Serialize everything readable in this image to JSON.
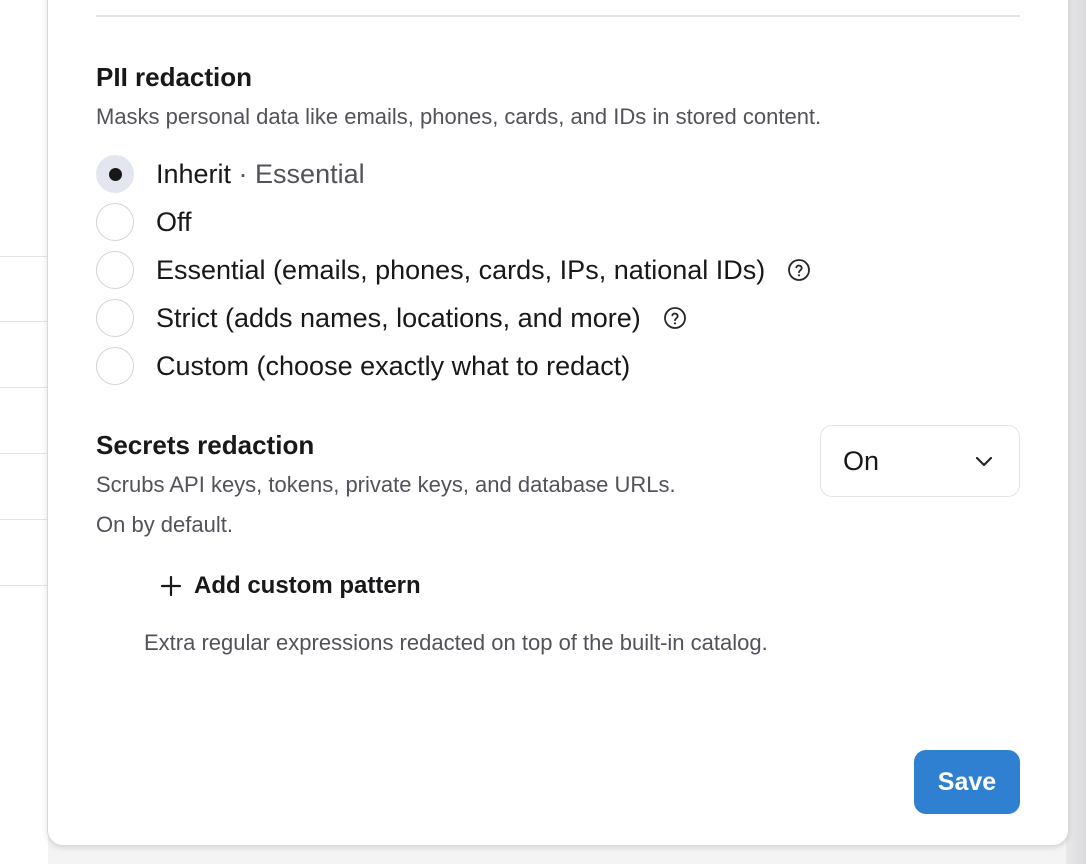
{
  "pii": {
    "title": "PII redaction",
    "description": "Masks personal data like emails, phones, cards, and IDs in stored content.",
    "options": [
      {
        "label": "Inherit",
        "sub": " · Essential",
        "checked": true,
        "help": false
      },
      {
        "label": "Off",
        "sub": "",
        "checked": false,
        "help": false
      },
      {
        "label": "Essential (emails, phones, cards, IPs, national IDs)",
        "sub": "",
        "checked": false,
        "help": true
      },
      {
        "label": "Strict (adds names, locations, and more)",
        "sub": "",
        "checked": false,
        "help": true
      },
      {
        "label": "Custom (choose exactly what to redact)",
        "sub": "",
        "checked": false,
        "help": false
      }
    ]
  },
  "secrets": {
    "title": "Secrets redaction",
    "description": "Scrubs API keys, tokens, private keys, and database URLs.",
    "default_note": "On by default.",
    "select_value": "On"
  },
  "custom_pattern": {
    "add_label": "Add custom pattern",
    "helper": "Extra regular expressions redacted on top of the built-in catalog."
  },
  "footer": {
    "save_label": "Save"
  },
  "colors": {
    "accent": "#2f80d1",
    "selected_radio_bg": "#e4e6ef"
  },
  "icons": {
    "help": "help-circle-icon",
    "chevron": "chevron-down-icon",
    "add": "plus-icon"
  }
}
